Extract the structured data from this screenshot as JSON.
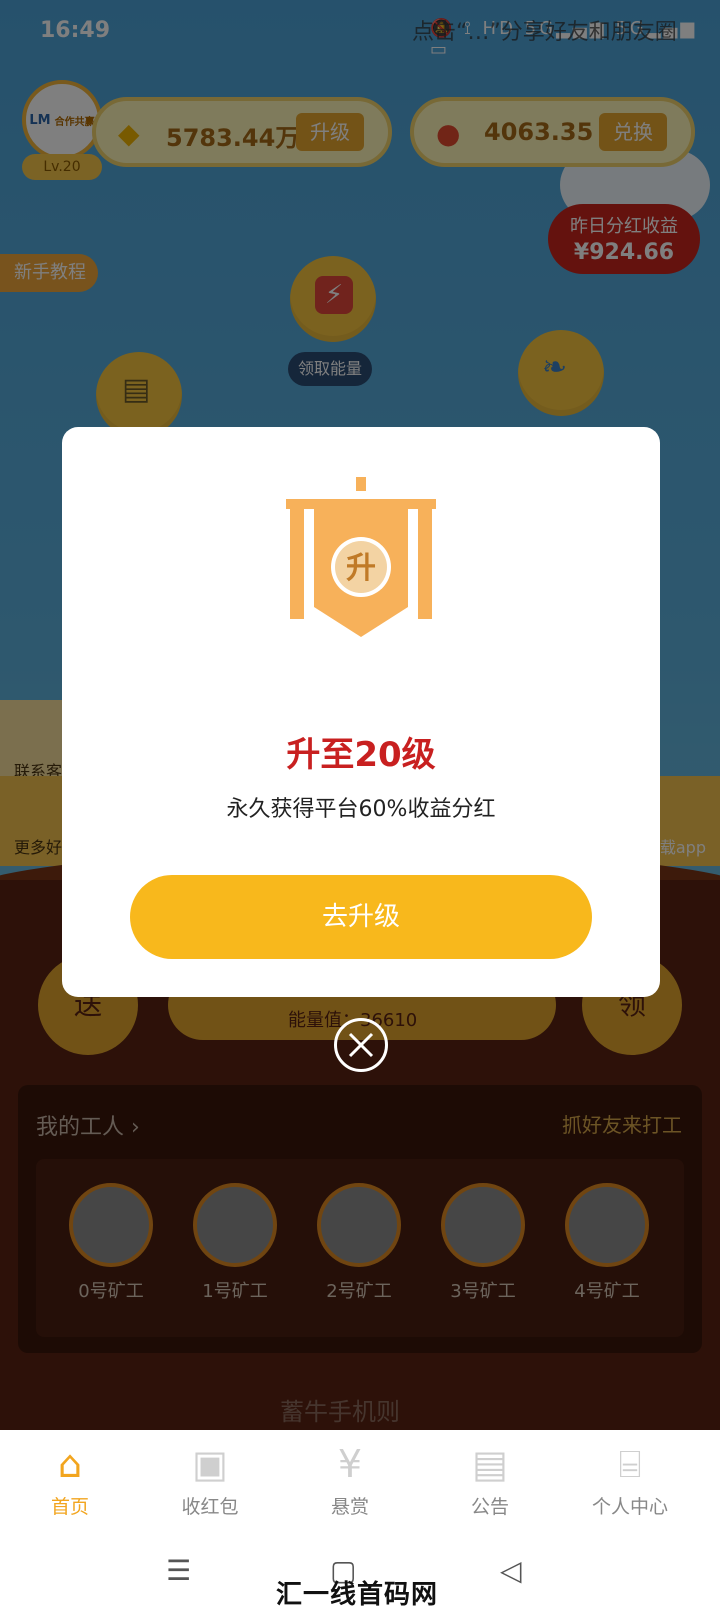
{
  "status": {
    "time": "16:49",
    "icons": "🔕 ⟟ HD 5G▂▄▆ 5G▂▄▆ ▭",
    "overlay": "点击“…”分享好友和朋友圈"
  },
  "header": {
    "avatar_text": "LM",
    "avatar_sub": "合作共赢",
    "level": "Lv.20",
    "diamond_value": "5783.44万",
    "upgrade_label": "升级",
    "coin_value": "4063.35",
    "exchange_label": "兑换"
  },
  "yesterday": {
    "title": "昨日分红收益",
    "value": "¥924.66"
  },
  "tutorial_label": "新手教程",
  "energy": {
    "icon": "⚡",
    "label": "领取能量"
  },
  "side": {
    "contact_label": "联系客",
    "more_label": "更多好",
    "app_label": "载app"
  },
  "game": {
    "left_char": "送",
    "right_char": "领",
    "energy_text": "能量值：36610"
  },
  "workers": {
    "title": "我的工人 ›",
    "invite": "抓好友来打工",
    "items": [
      "0号矿工",
      "1号矿工",
      "2号矿工",
      "3号矿工",
      "4号矿工"
    ]
  },
  "rules": "蓄牛手机则",
  "modal": {
    "badge_char": "升",
    "title": "升至20级",
    "subtitle": "永久获得平台60%收益分红",
    "cta": "去升级"
  },
  "tabs": [
    {
      "label": "首页",
      "icon": "home-icon"
    },
    {
      "label": "收红包",
      "icon": "redpacket-icon"
    },
    {
      "label": "悬赏",
      "icon": "money-bag-icon"
    },
    {
      "label": "公告",
      "icon": "announcement-icon"
    },
    {
      "label": "个人中心",
      "icon": "shop-icon"
    }
  ],
  "watermark": "汇一线首码网 www.huiyixian.com",
  "colors": {
    "accent": "#f8b81c",
    "title_red": "#c82020",
    "sky": "#5aa7d6",
    "ground": "#5a2312"
  }
}
